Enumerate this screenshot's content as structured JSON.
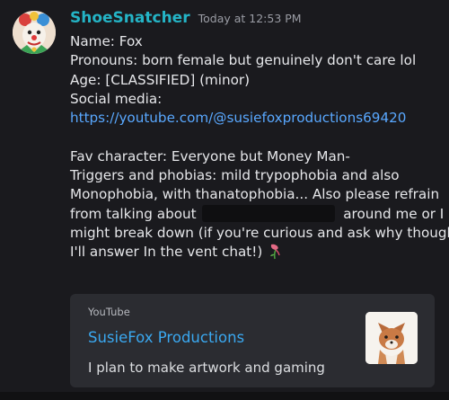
{
  "message": {
    "username": "ShoeSnatcher",
    "timestamp": "Today at 12:53 PM",
    "lines": [
      "Name: Fox",
      "Pronouns: born female but genuinely don't care lol",
      "Age: [CLASSIFIED] (minor)",
      "Social media:",
      "https://youtube.com/@susiefoxproductions69420",
      "",
      "Fav character: Everyone but Money Man-",
      "Triggers and phobias: mild trypophobia and also",
      "Monophobia, with thanatophobia... Also please refrain",
      "from talking about",
      "around me or I",
      "might break down (if you're curious and ask why though",
      "I'll answer In the vent chat!)"
    ]
  },
  "embed": {
    "provider": "YouTube",
    "title": "SusieFox Productions",
    "description": "I plan to make artwork and gaming"
  },
  "icons": {
    "avatar": "clown-avatar",
    "emoji": "wilted-flower-emoji",
    "thumbnail": "fox-thumbnail"
  },
  "colors": {
    "username": "#24b4c6",
    "link": "#59a8ff",
    "embed_title": "#3aa8f0",
    "background": "#1a1a1e",
    "embed_background": "#2b2c31"
  }
}
